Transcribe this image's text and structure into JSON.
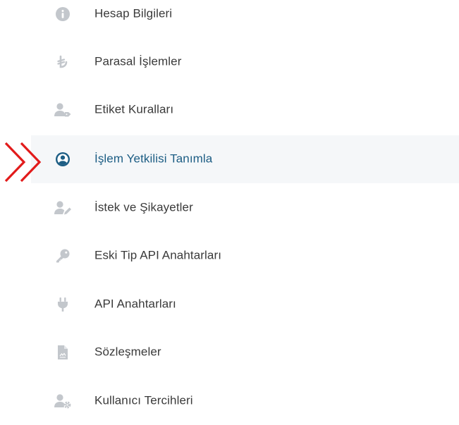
{
  "menu": {
    "items": [
      {
        "label": "Hesap Bilgileri",
        "icon": "info-circle-icon"
      },
      {
        "label": "Parasal İşlemler",
        "icon": "lira-icon"
      },
      {
        "label": "Etiket Kuralları",
        "icon": "user-tag-icon"
      },
      {
        "label": "İşlem Yetkilisi Tanımla",
        "icon": "user-circle-icon",
        "active": true
      },
      {
        "label": "İstek ve Şikayetler",
        "icon": "user-edit-icon"
      },
      {
        "label": "Eski Tip API Anahtarları",
        "icon": "key-icon"
      },
      {
        "label": "API Anahtarları",
        "icon": "plug-icon"
      },
      {
        "label": "Sözleşmeler",
        "icon": "document-icon"
      },
      {
        "label": "Kullanıcı Tercihleri",
        "icon": "user-cog-icon"
      }
    ]
  },
  "colors": {
    "icon_inactive": "#c3c7cc",
    "icon_active": "#1c5d84",
    "label_text": "#3a3a3a",
    "label_active": "#1c5d84",
    "active_background": "#f5f7f9",
    "pointer_arrow": "#e21b1b"
  }
}
